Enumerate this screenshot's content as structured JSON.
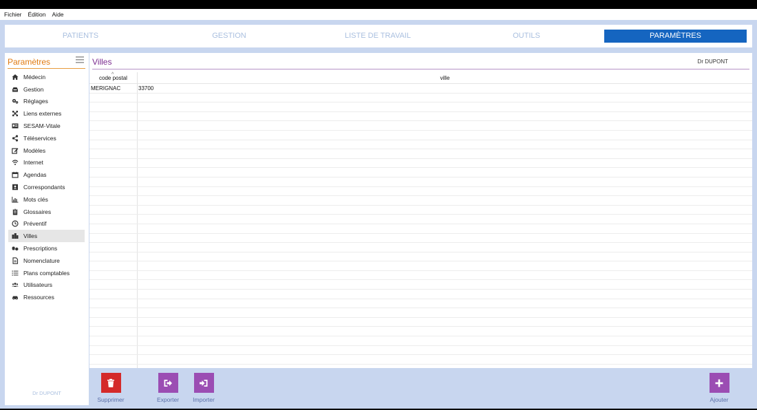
{
  "menubar": {
    "items": [
      "Fichier",
      "Édition",
      "Aide"
    ]
  },
  "topnav": {
    "tabs": [
      {
        "label": "PATIENTS",
        "active": false
      },
      {
        "label": "GESTION",
        "active": false
      },
      {
        "label": "LISTE DE TRAVAIL",
        "active": false
      },
      {
        "label": "OUTILS",
        "active": false
      },
      {
        "label": "PARAMÈTRES",
        "active": true
      }
    ]
  },
  "sidebar": {
    "title": "Paramètres",
    "items": [
      {
        "label": "Médecin",
        "icon": "home-icon"
      },
      {
        "label": "Gestion",
        "icon": "tray-icon"
      },
      {
        "label": "Réglages",
        "icon": "gears-icon"
      },
      {
        "label": "Liens externes",
        "icon": "expand-arrows-icon"
      },
      {
        "label": "SESAM-Vitale",
        "icon": "card-icon"
      },
      {
        "label": "Téléservices",
        "icon": "share-icon"
      },
      {
        "label": "Modèles",
        "icon": "edit-icon"
      },
      {
        "label": "Internet",
        "icon": "wifi-icon"
      },
      {
        "label": "Agendas",
        "icon": "calendar-icon"
      },
      {
        "label": "Correspondants",
        "icon": "contact-card-icon"
      },
      {
        "label": "Mots clés",
        "icon": "bar-chart-icon"
      },
      {
        "label": "Glossaires",
        "icon": "clipboard-icon"
      },
      {
        "label": "Préventif",
        "icon": "clock-icon"
      },
      {
        "label": "Villes",
        "icon": "building-icon",
        "selected": true
      },
      {
        "label": "Prescriptions",
        "icon": "pills-icon"
      },
      {
        "label": "Nomenclature",
        "icon": "document-icon"
      },
      {
        "label": "Plans comptables",
        "icon": "list-icon"
      },
      {
        "label": "Utilisateurs",
        "icon": "users-icon"
      },
      {
        "label": "Ressources",
        "icon": "car-icon"
      }
    ],
    "footer": "Dr DUPONT"
  },
  "main": {
    "title": "Villes",
    "user": "Dr DUPONT",
    "sort_indicator": "^",
    "columns": [
      "code postal",
      "ville"
    ],
    "rows": [
      [
        "MERIGNAC",
        "33700"
      ]
    ]
  },
  "actions": {
    "delete": "Supprimer",
    "export": "Exporter",
    "import": "Importer",
    "add": "Ajouter"
  },
  "colors": {
    "accent_blue": "#1565c0",
    "sidebar_title": "#e07a10",
    "main_title": "#7b2b8f",
    "delete_button": "#d42a2a",
    "action_button": "#9b4db3",
    "background": "#c8d6ef"
  }
}
